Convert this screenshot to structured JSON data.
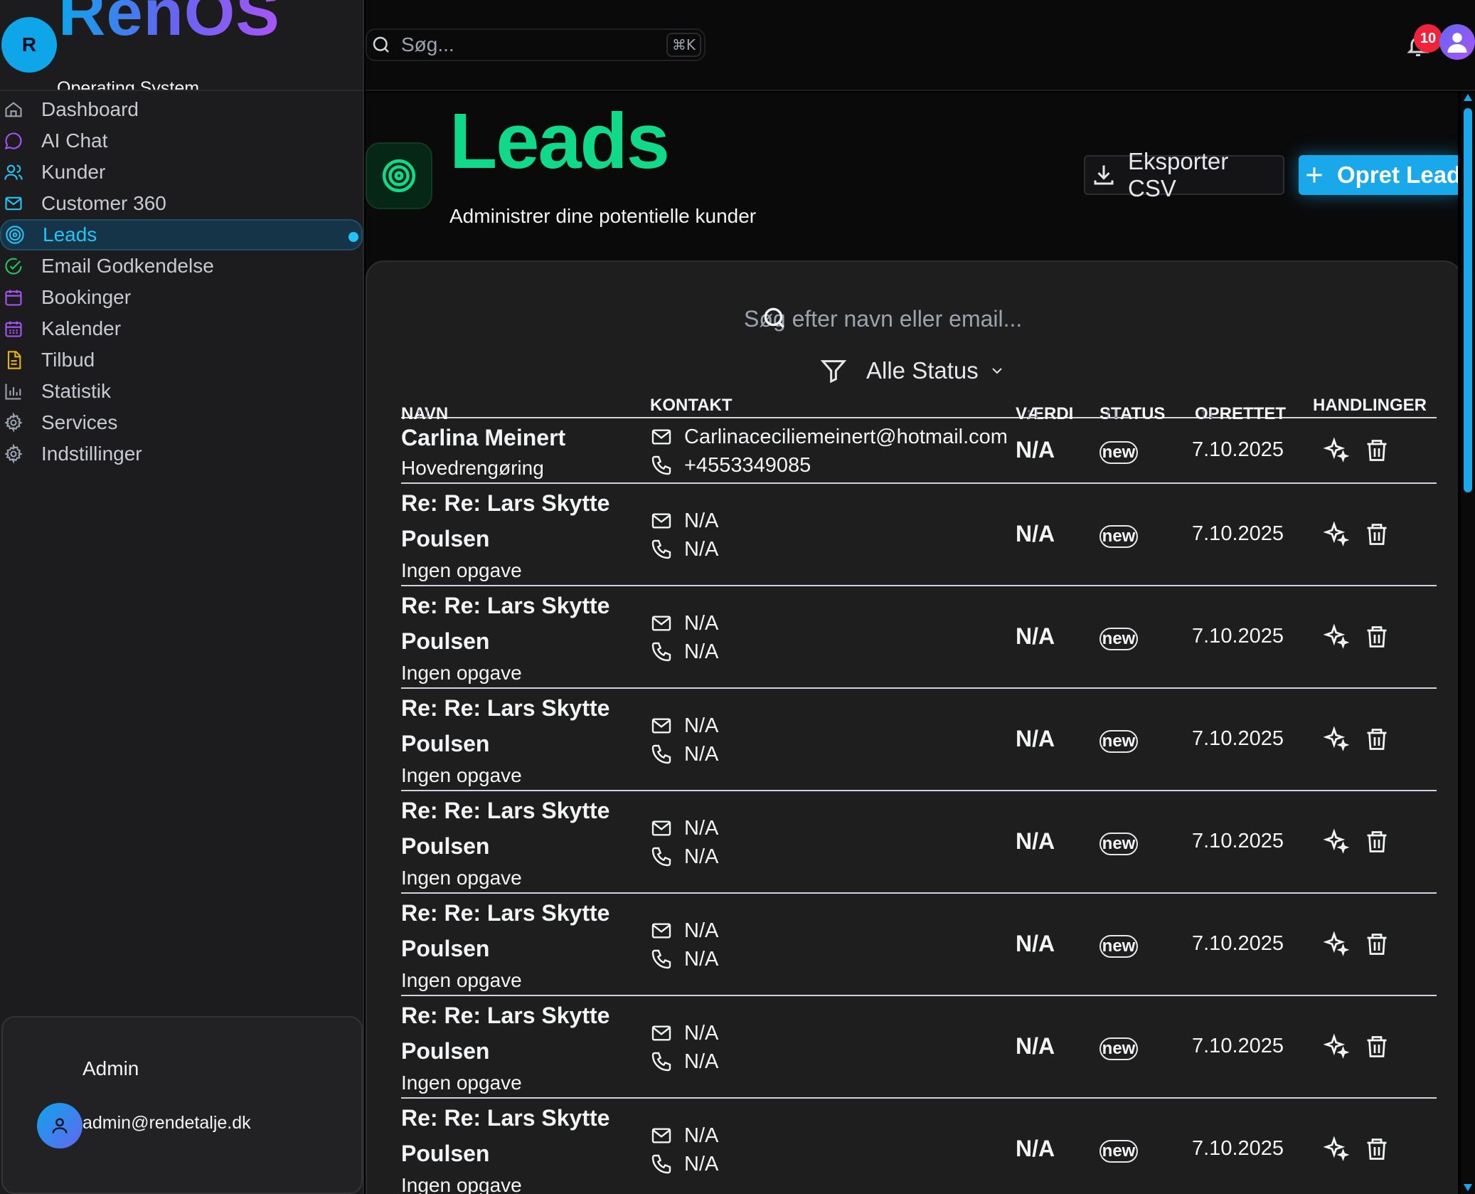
{
  "brand": {
    "avatar_letter": "R",
    "title": "RenOS",
    "subtitle": "Operating System"
  },
  "sidebar": {
    "items": [
      {
        "label": "Dashboard",
        "icon": "home-icon",
        "color": "#9ca3af"
      },
      {
        "label": "AI Chat",
        "icon": "chat-icon",
        "color": "#a855f7"
      },
      {
        "label": "Kunder",
        "icon": "users-icon",
        "color": "#22c3f5"
      },
      {
        "label": "Customer 360",
        "icon": "mail-icon",
        "color": "#22c3f5"
      },
      {
        "label": "Leads",
        "icon": "target-icon",
        "color": "#22c3f5",
        "active": true
      },
      {
        "label": "Email Godkendelse",
        "icon": "check-circle-icon",
        "color": "#22c55e"
      },
      {
        "label": "Bookinger",
        "icon": "calendar-icon",
        "color": "#a855f7"
      },
      {
        "label": "Kalender",
        "icon": "calendar-grid-icon",
        "color": "#a855f7"
      },
      {
        "label": "Tilbud",
        "icon": "document-icon",
        "color": "#eab308"
      },
      {
        "label": "Statistik",
        "icon": "bar-chart-icon",
        "color": "#9ca3af"
      },
      {
        "label": "Services",
        "icon": "gear-icon",
        "color": "#9ca3af"
      },
      {
        "label": "Indstillinger",
        "icon": "gear-icon",
        "color": "#9ca3af"
      }
    ]
  },
  "user": {
    "name": "Admin",
    "email": "admin@rendetalje.dk"
  },
  "topbar": {
    "search_placeholder": "Søg...",
    "shortcut": "⌘K",
    "notification_count": "10"
  },
  "page": {
    "title": "Leads",
    "subtitle": "Administrer dine potentielle kunder",
    "export_label": "Eksporter CSV",
    "create_label": "Opret Lead",
    "accent": "#10d98a"
  },
  "filters": {
    "search_placeholder": "Søg efter navn eller email...",
    "status_label": "Alle Status"
  },
  "table": {
    "columns": {
      "name": "NAVN",
      "contact": "KONTAKT",
      "value": "VÆRDI",
      "status": "STATUS",
      "created": "OPRETTET",
      "actions": "HANDLINGER"
    },
    "sort_glyph": "↑↓",
    "rows": [
      {
        "name": "Carlina Meinert",
        "task": "Hovedrengøring",
        "email": "Carlinaceciliemeinert@hotmail.com",
        "phone": "+4553349085",
        "value": "N/A",
        "status": "new",
        "created": "7.10.2025"
      },
      {
        "name": "Re: Re: Lars Skytte Poulsen",
        "task": "Ingen opgave",
        "email": "N/A",
        "phone": "N/A",
        "value": "N/A",
        "status": "new",
        "created": "7.10.2025"
      },
      {
        "name": "Re: Re: Lars Skytte Poulsen",
        "task": "Ingen opgave",
        "email": "N/A",
        "phone": "N/A",
        "value": "N/A",
        "status": "new",
        "created": "7.10.2025"
      },
      {
        "name": "Re: Re: Lars Skytte Poulsen",
        "task": "Ingen opgave",
        "email": "N/A",
        "phone": "N/A",
        "value": "N/A",
        "status": "new",
        "created": "7.10.2025"
      },
      {
        "name": "Re: Re: Lars Skytte Poulsen",
        "task": "Ingen opgave",
        "email": "N/A",
        "phone": "N/A",
        "value": "N/A",
        "status": "new",
        "created": "7.10.2025"
      },
      {
        "name": "Re: Re: Lars Skytte Poulsen",
        "task": "Ingen opgave",
        "email": "N/A",
        "phone": "N/A",
        "value": "N/A",
        "status": "new",
        "created": "7.10.2025"
      },
      {
        "name": "Re: Re: Lars Skytte Poulsen",
        "task": "Ingen opgave",
        "email": "N/A",
        "phone": "N/A",
        "value": "N/A",
        "status": "new",
        "created": "7.10.2025"
      },
      {
        "name": "Re: Re: Lars Skytte Poulsen",
        "task": "Ingen opgave",
        "email": "N/A",
        "phone": "N/A",
        "value": "N/A",
        "status": "new",
        "created": "7.10.2025"
      }
    ]
  }
}
